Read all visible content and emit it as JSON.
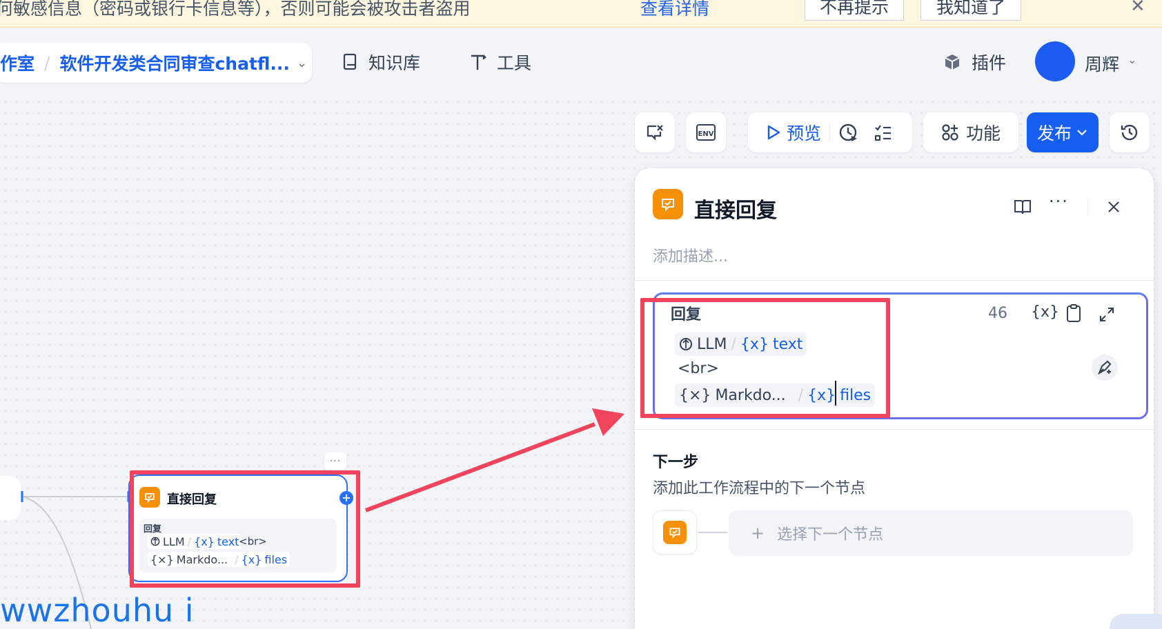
{
  "banner": {
    "text": "何敏感信息（密码或银行卡信息等），否则可能会被攻击者盗用",
    "link": "查看详情",
    "dismiss_label": "不再提示",
    "ack_label": "我知道了"
  },
  "nav": {
    "workspace": "作室",
    "app_name": "软件开发类合同审查chatfl...",
    "knowledge": "知识库",
    "tools": "工具",
    "plugins": "插件",
    "user": "周辉"
  },
  "toolbar": {
    "env_label": "ENV",
    "preview": "预览",
    "features": "功能",
    "publish": "发布"
  },
  "panel": {
    "title": "直接回复",
    "description_placeholder": "添加描述...",
    "reply_label": "回复",
    "char_count": "46",
    "var_symbol": "{x}",
    "chip_llm_source": "LLM",
    "chip_llm_var": "text",
    "br_text": "<br>",
    "chip_md_source": "Markdo...",
    "chip_md_var": "files",
    "next_title": "下一步",
    "next_desc": "添加此工作流程中的下一个节点",
    "select_next": "选择下一个节点"
  },
  "canvas_node": {
    "title": "直接回复",
    "label": "回复",
    "chip_llm_source": "LLM",
    "chip_llm_var": "text",
    "br_text": "<br>",
    "chip_md_source": "Markdo...",
    "chip_md_var": "files"
  },
  "watermark": "wwzhouhu i",
  "colors": {
    "accent": "#155eef",
    "node_orange": "#f79009",
    "highlight": "#f0435c",
    "banner_bg": "#fef7e0"
  }
}
